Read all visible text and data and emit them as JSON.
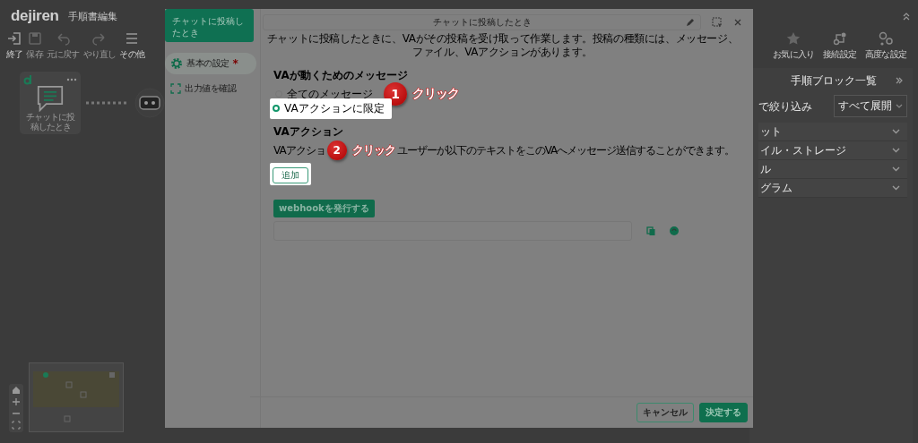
{
  "app": {
    "logo": "dejiren",
    "title": "手順書編集",
    "toolbar": [
      {
        "kind": "exit",
        "label": "終了",
        "disabled": false
      },
      {
        "kind": "save",
        "label": "保存",
        "disabled": true
      },
      {
        "kind": "undo",
        "label": "元に戻す",
        "disabled": true
      },
      {
        "kind": "redo",
        "label": "やり直し",
        "disabled": true
      },
      {
        "kind": "more",
        "label": "その他",
        "disabled": false
      }
    ],
    "right_toolbar": [
      {
        "kind": "star",
        "label": "お気に入り"
      },
      {
        "kind": "connect",
        "label": "接続設定"
      },
      {
        "kind": "advanced",
        "label": "高度な設定"
      }
    ]
  },
  "canvas": {
    "node": {
      "label": "チャットに投稿したとき"
    }
  },
  "block_panel": {
    "title": "手順ブロック一覧",
    "filter_placeholder": "で絞り込み",
    "expand": "すべて展開",
    "categories": [
      "ット",
      "イル・ストレージ",
      "ル",
      "グラム"
    ]
  },
  "dialog": {
    "tab": "チャットに投稿したとき",
    "nav": [
      {
        "kind": "settings",
        "label": "基本の設定",
        "required_mark": "*",
        "selected": true
      },
      {
        "kind": "output",
        "label": "出力値を確認",
        "selected": false
      }
    ],
    "title": "チャットに投稿したとき",
    "description": "チャットに投稿したときに、VAがその投稿を受け取って作業します。投稿の種類には、メッセージ、ファイル、VAアクションがあります。",
    "message_heading": "VAが動くためのメッセージ",
    "options": [
      {
        "label": "全てのメッセージ",
        "selected": false,
        "highlighted": false
      },
      {
        "label": "VAアクションに限定",
        "selected": true,
        "highlighted": true
      }
    ],
    "action_heading": "VAアクション",
    "action_description_start": "VAアクショ",
    "action_description_end": "ユーザーが以下のテキストをこのVAへメッセージ送信することができます。",
    "add_button": {
      "label": "追加",
      "highlighted": true
    },
    "webhook_button": "webhookを発行する",
    "buttons": [
      {
        "kind": "secondary",
        "label": "キャンセル"
      },
      {
        "kind": "primary",
        "label": "決定する"
      }
    ]
  },
  "annotations": [
    {
      "number": "1",
      "text": "クリック"
    },
    {
      "number": "2",
      "text": "クリック"
    }
  ]
}
